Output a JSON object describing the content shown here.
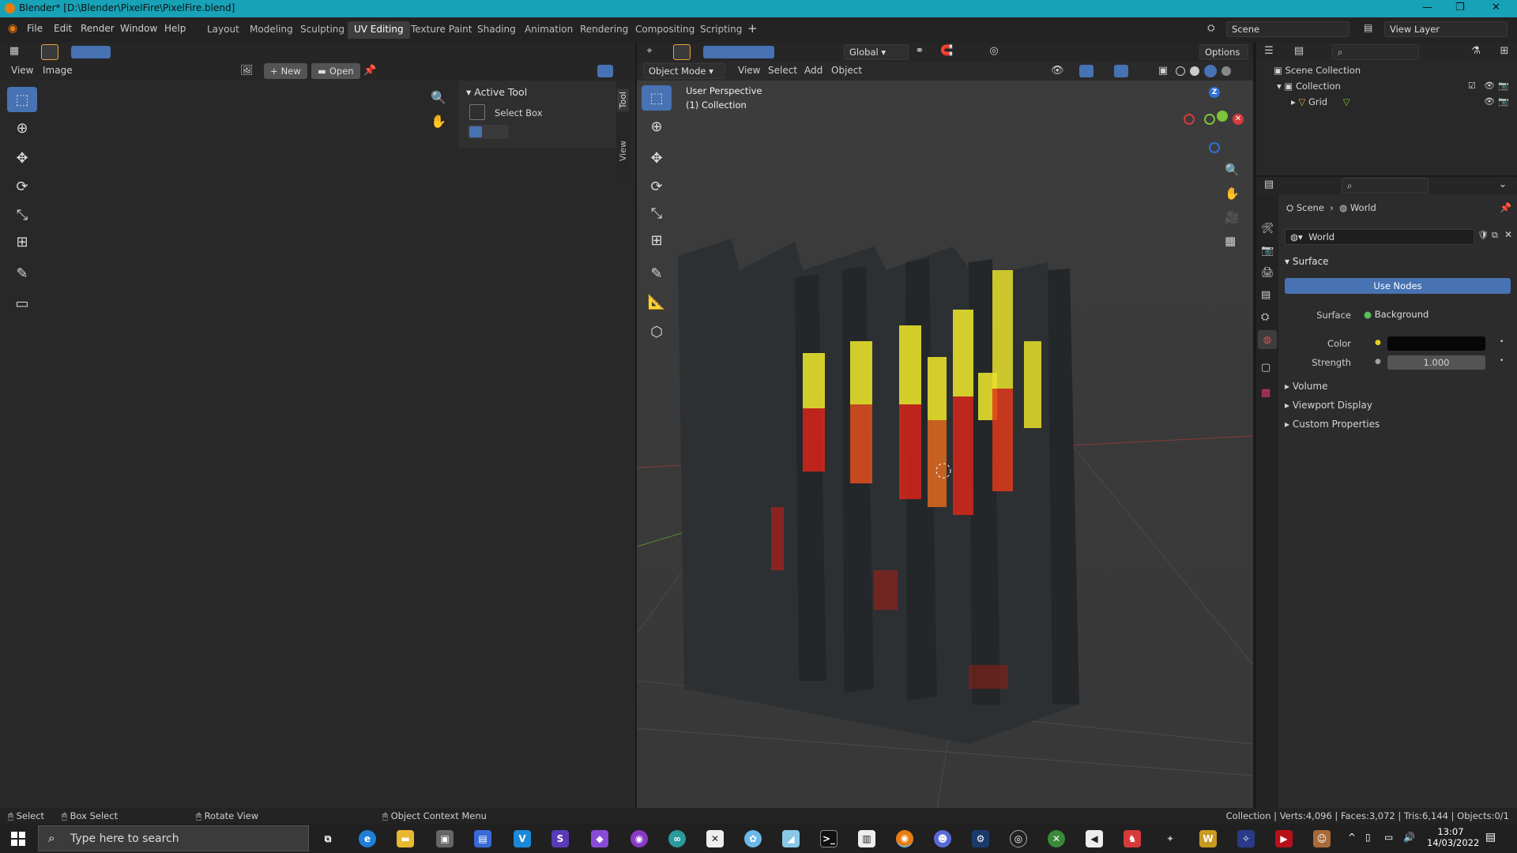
{
  "window": {
    "title": "Blender* [D:\\Blender\\PixelFire\\PixelFire.blend]"
  },
  "menus": [
    "File",
    "Edit",
    "Render",
    "Window",
    "Help"
  ],
  "workspace_tabs": [
    "Layout",
    "Modeling",
    "Sculpting",
    "UV Editing",
    "Texture Paint",
    "Shading",
    "Animation",
    "Rendering",
    "Compositing",
    "Scripting"
  ],
  "active_tab": "UV Editing",
  "scene_field": "Scene",
  "view_layer_field": "View Layer",
  "uv_editor": {
    "menu_view": "View",
    "menu_image": "Image",
    "new_label": "New",
    "open_label": "Open",
    "side_tabs": [
      "Tool",
      "View"
    ],
    "active_tool_title": "Active Tool",
    "active_tool_name": "Select Box"
  },
  "viewport": {
    "mode": "Object Mode",
    "menus": [
      "View",
      "Select",
      "Add",
      "Object"
    ],
    "transform": "Global",
    "options": "Options",
    "overlay_line1": "User Perspective",
    "overlay_line2": "(1) Collection",
    "gizmo_z": "Z"
  },
  "outliner": {
    "root": "Scene Collection",
    "collection": "Collection",
    "object": "Grid"
  },
  "properties": {
    "breadcrumb_scene": "Scene",
    "breadcrumb_world": "World",
    "world_name": "World",
    "surface_panel": "Surface",
    "use_nodes": "Use Nodes",
    "surface_label": "Surface",
    "surface_value": "Background",
    "color_label": "Color",
    "strength_label": "Strength",
    "strength_value": "1.000",
    "collapsed_panels": [
      "Volume",
      "Viewport Display",
      "Custom Properties"
    ],
    "world_color": "#070707"
  },
  "statusbar": {
    "select": "Select",
    "box_select": "Box Select",
    "rotate_view": "Rotate View",
    "context_menu": "Object Context Menu",
    "stats": "Collection | Verts:4,096 | Faces:3,072 | Tris:6,144 | Objects:0/1"
  },
  "taskbar": {
    "search_placeholder": "Type here to search",
    "time": "13:07",
    "date": "14/03/2022"
  },
  "colors": {
    "accent": "#4772b3",
    "titlebar": "#17a2b8",
    "fire_yellow": "#e6e02a",
    "fire_red": "#d8261a"
  }
}
